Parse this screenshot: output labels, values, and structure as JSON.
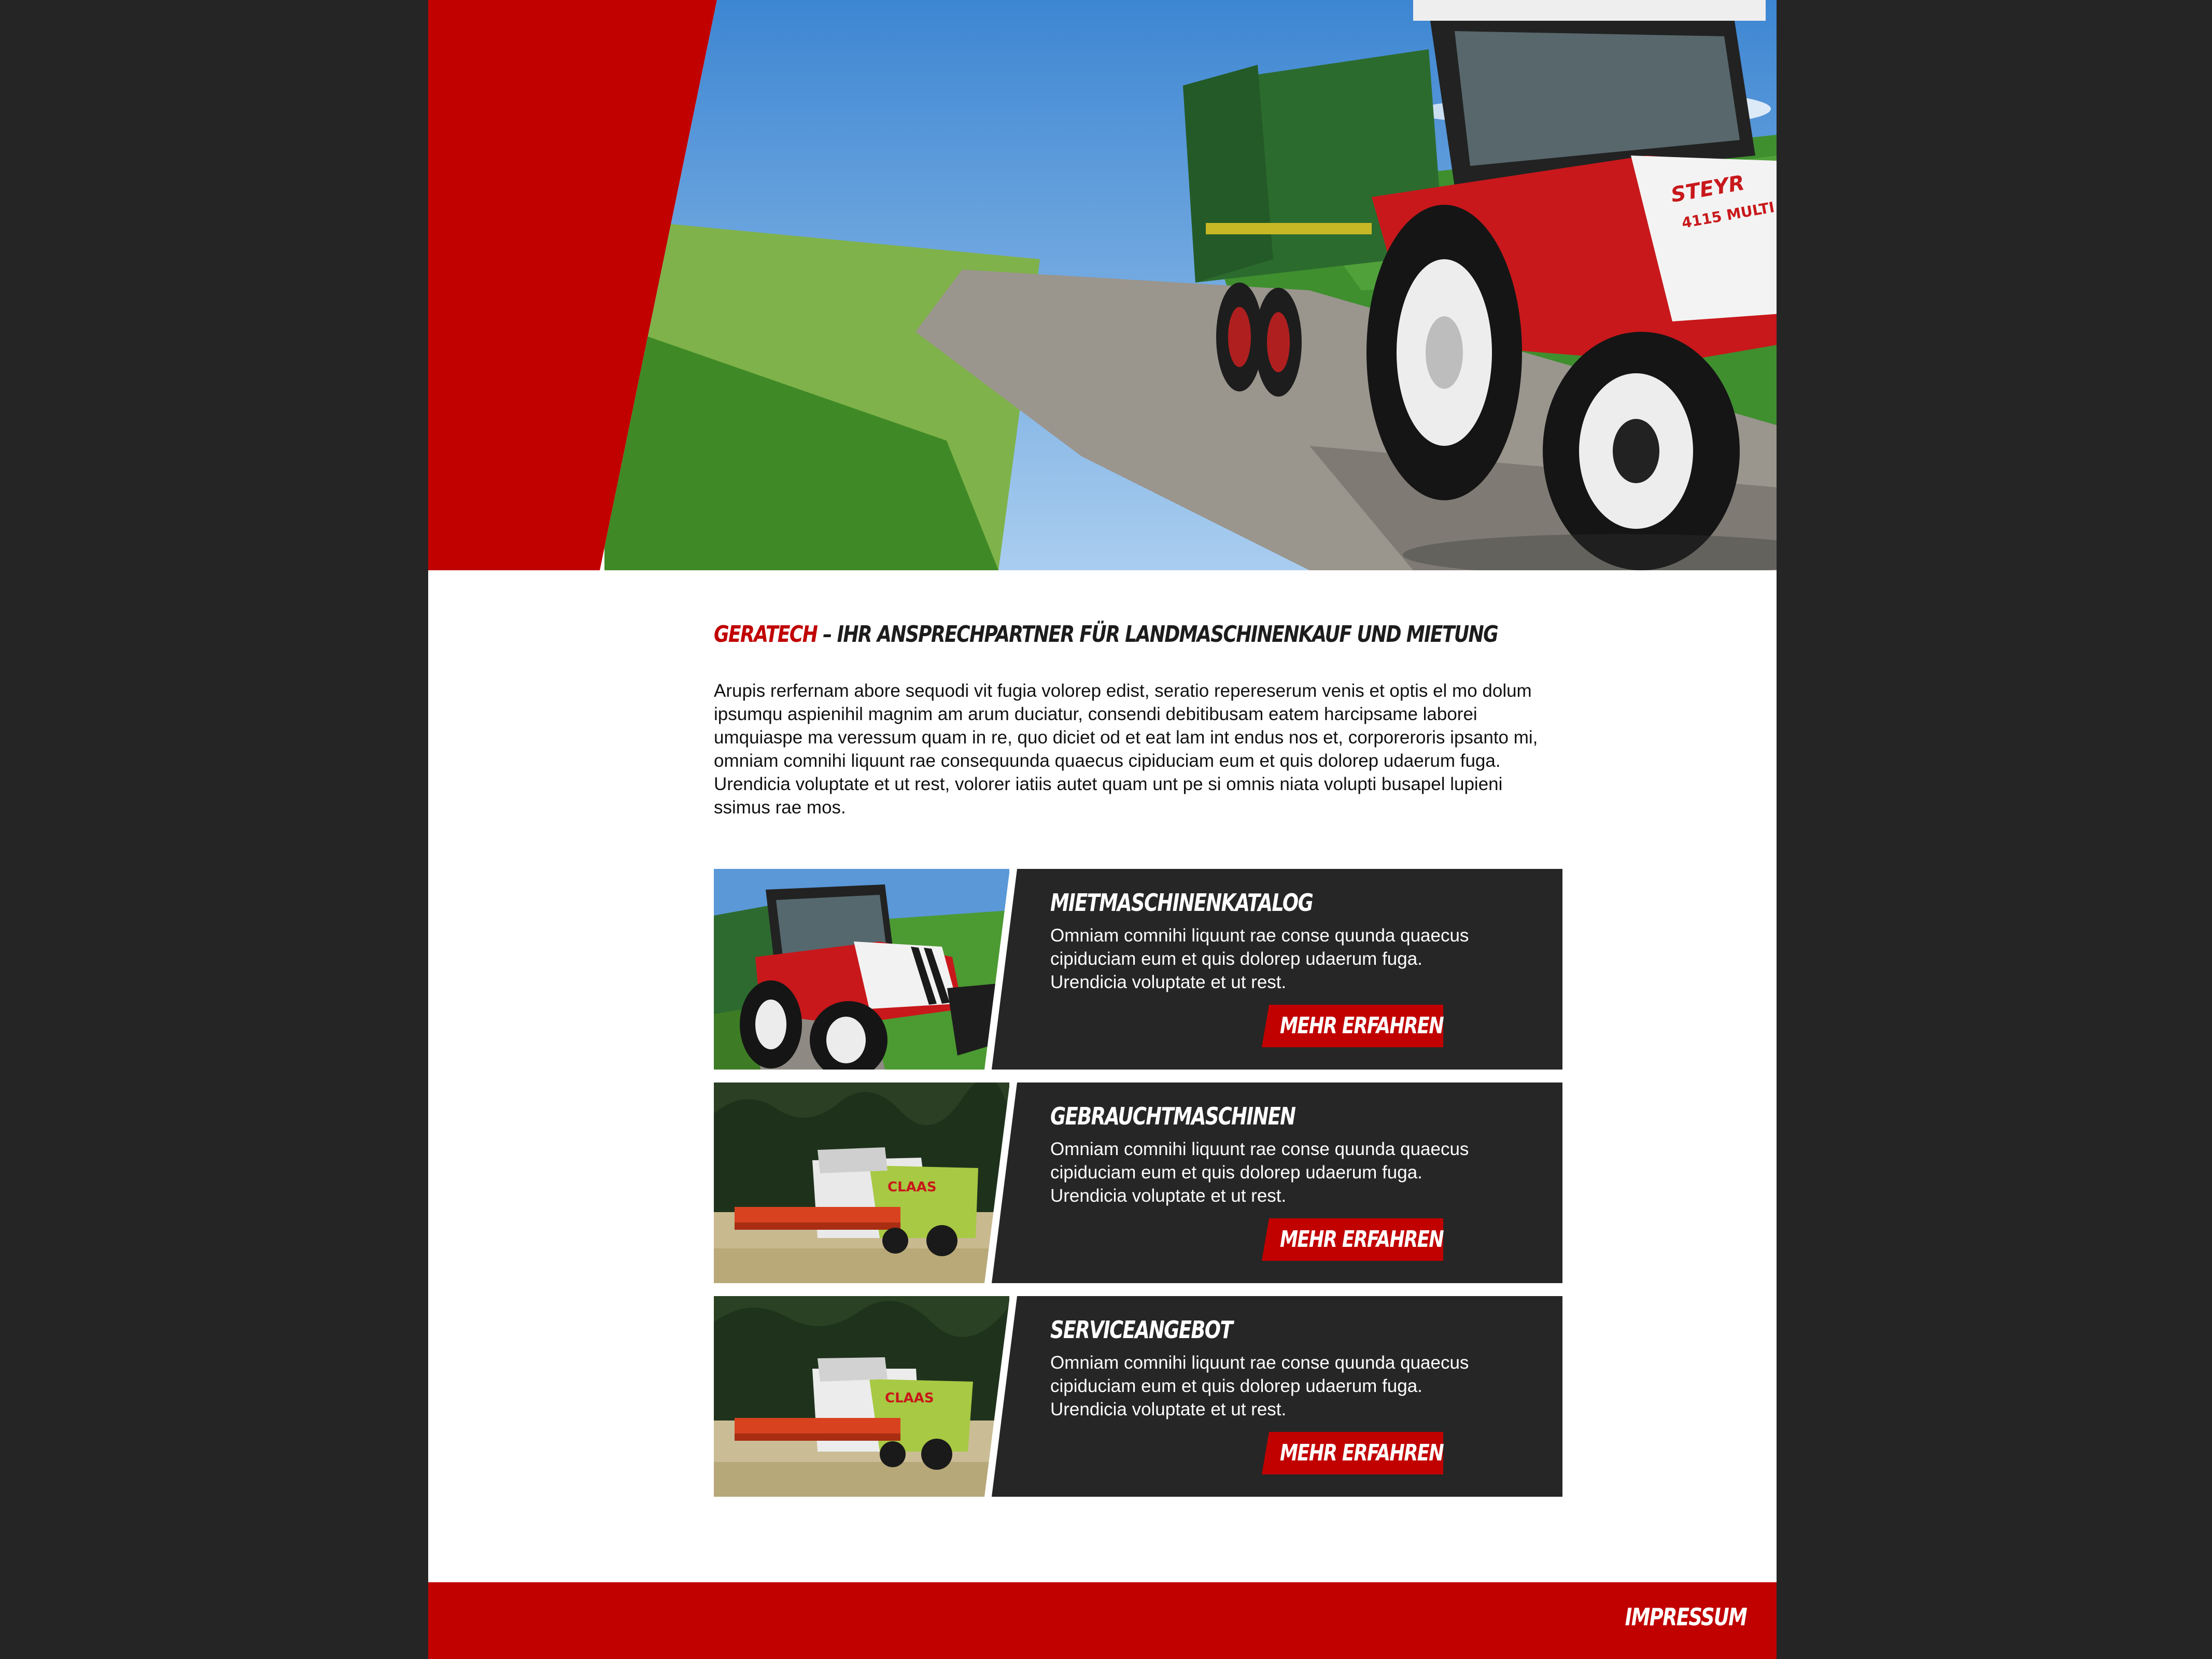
{
  "hero": {
    "image": "tractor-with-trailer-photo",
    "tractor_brand": "STEYR",
    "tractor_model": "4115 MULTI"
  },
  "intro": {
    "brand": "GERATECH",
    "headline_rest": " – IHR ANSPRECHPARTNER FÜR LANDMASCHINENKAUF UND MIETUNG",
    "text": "Arupis rerfernam abore sequodi vit fugia volorep edist, seratio repereserum venis et optis el mo dolum ipsumqu aspienihil magnim am arum duciatur, consendi debitibusam eatem harcipsame laborei umquiaspe ma veressum quam in re, quo diciet od et eat lam int endus nos et, corporeroris ipsanto mi, omniam comnihi liquunt rae consequunda quaecus cipiduciam eum et quis dolorep udaerum fuga. Urendicia voluptate et ut rest, volorer iatiis autet quam unt pe si omnis niata volupti busapel lupieni ssimus rae mos."
  },
  "cards": [
    {
      "title": "MIETMASCHINENKATALOG",
      "text": "Omniam comnihi liquunt rae conse quunda quaecus cipiduciam eum et quis dolorep udaerum fuga. Urendicia voluptate et ut rest.",
      "button": "MEHR ERFAHREN",
      "image": "tractor-photo"
    },
    {
      "title": "GEBRAUCHTMASCHINEN",
      "text": "Omniam comnihi liquunt rae conse quunda quaecus cipiduciam eum et quis dolorep udaerum fuga. Urendicia voluptate et ut rest.",
      "button": "MEHR ERFAHREN",
      "image": "combine-harvester-photo",
      "machine_brand": "CLAAS"
    },
    {
      "title": "SERVICEANGEBOT",
      "text": "Omniam comnihi liquunt rae conse quunda quaecus cipiduciam eum et quis dolorep udaerum fuga. Urendicia voluptate et ut rest.",
      "button": "MEHR ERFAHREN",
      "image": "combine-harvester-photo",
      "machine_brand": "CLAAS"
    }
  ],
  "footer": {
    "link": "IMPRESSUM"
  },
  "colors": {
    "accent": "#c10000",
    "dark": "#252525",
    "panel": "#262626",
    "page": "#ffffff"
  }
}
